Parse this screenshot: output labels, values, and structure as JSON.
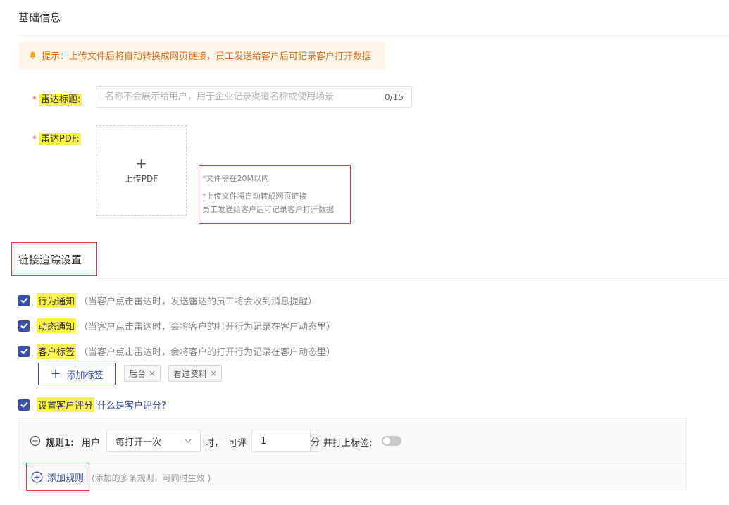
{
  "basic": {
    "section_title": "基础信息",
    "tip_text": "提示：上传文件后将自动转换成网页链接，员工发送给客户后可记录客户打开数据",
    "title_field": {
      "required_mark": "*",
      "label": "雷达标题:",
      "placeholder": "名称不会展示给用户，用于企业记录渠道名称或使用场景",
      "value": "",
      "counter": "0/15"
    },
    "pdf_field": {
      "required_mark": "*",
      "label": "雷达PDF:",
      "upload_icon": "+",
      "upload_label": "上传PDF",
      "hints": [
        "*文件需在20M以内",
        "*上传文件将自动转成网页链接",
        "员工发送给客户后可记录客户打开数据"
      ]
    }
  },
  "tracking": {
    "section_title": "链接追踪设置",
    "options": [
      {
        "label": "行为通知",
        "desc": "（当客户点击雷达时，发送雷达的员工将会收到消息提醒）",
        "checked": true
      },
      {
        "label": "动态通知",
        "desc": "（当客户点击雷达时，会将客户的打开行为记录在客户动态里）",
        "checked": true
      },
      {
        "label": "客户标签",
        "desc": "（当客户点击雷达时，会将客户的打开行为记录在客户动态里）",
        "checked": true
      }
    ],
    "add_tag_icon": "+",
    "add_tag_label": "添加标签",
    "tags": [
      {
        "label": "后台",
        "remove": "×"
      },
      {
        "label": "看过资料",
        "remove": "×"
      }
    ],
    "score": {
      "label": "设置客户评分",
      "link": "什么是客户评分?",
      "checked": true
    }
  },
  "rules": {
    "items": [
      {
        "title": "规则1:",
        "user_label": "用户",
        "frequency": "每打开一次",
        "time_suffix": "时，",
        "score_label": "可评",
        "score_value": "1",
        "unit": "分",
        "tag_toggle_label": "并打上标签:",
        "tag_toggle_on": false
      }
    ],
    "add_rule_label": "添加规则",
    "add_rule_note": "(添加的多条规则，可同时生效 )"
  },
  "colors": {
    "primary": "#3b4fa8",
    "highlight": "#fbf24d",
    "warning": "#e6721f",
    "annotation_red": "#d64040"
  }
}
